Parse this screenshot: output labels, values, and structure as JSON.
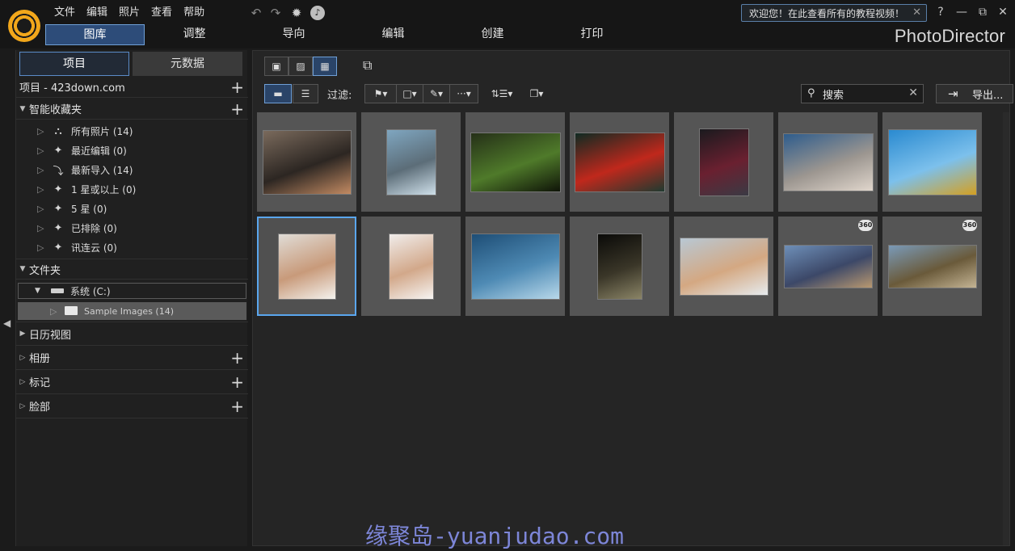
{
  "menu": [
    "文件",
    "编辑",
    "照片",
    "查看",
    "帮助"
  ],
  "welcome": "欢迎您！在此查看所有的教程视频！",
  "window_controls": {
    "help": "?",
    "minimize": "—",
    "restore": "⧉",
    "close": "✕"
  },
  "mode_tabs": [
    "图库",
    "调整",
    "导向",
    "编辑",
    "创建",
    "打印"
  ],
  "brand": "PhotoDirector",
  "left_tabs": [
    "项目",
    "元数据"
  ],
  "project_label": "项目 - 423down.com",
  "sections": {
    "smart": "智能收藏夹",
    "folder": "文件夹",
    "calendar": "日历视图",
    "album": "相册",
    "tags": "标记",
    "faces": "脸部"
  },
  "smart_items": [
    {
      "label": "所有照片 (14)",
      "icon": "tree-icon"
    },
    {
      "label": "最近编辑 (0)",
      "icon": "sparkle-icon"
    },
    {
      "label": "最新导入 (14)",
      "icon": "import-arrow-icon"
    },
    {
      "label": "1 星或以上 (0)",
      "icon": "sparkle-icon"
    },
    {
      "label": "5 星 (0)",
      "icon": "sparkle-icon"
    },
    {
      "label": "已排除 (0)",
      "icon": "sparkle-icon"
    },
    {
      "label": "讯连云 (0)",
      "icon": "sparkle-icon"
    }
  ],
  "folder_items": [
    "系统 (C:)",
    "Sample Images (14)"
  ],
  "toolbar": {
    "filter_label": "过滤:",
    "search_placeholder": "搜索",
    "export_label": "导出..."
  },
  "thumbnails": [
    {
      "name": "basketball-dunk",
      "colors": [
        "#7a6a5c",
        "#2c2622",
        "#c28a62"
      ],
      "badge": ""
    },
    {
      "name": "sea-rock",
      "colors": [
        "#7fa6c0",
        "#5c6d78",
        "#cfe0ea"
      ],
      "badge": ""
    },
    {
      "name": "forest",
      "colors": [
        "#253018",
        "#4f7a2a",
        "#0f1408"
      ],
      "badge": ""
    },
    {
      "name": "red-leaf",
      "colors": [
        "#0f2a22",
        "#c0281c",
        "#1f3a30"
      ],
      "badge": ""
    },
    {
      "name": "neon-building",
      "colors": [
        "#1a1a1e",
        "#6a2030",
        "#3a3a44"
      ],
      "badge": ""
    },
    {
      "name": "rocket-launch",
      "colors": [
        "#2e5c8c",
        "#9c9690",
        "#e0d6cc"
      ],
      "badge": ""
    },
    {
      "name": "skateboarder",
      "colors": [
        "#2a8ad0",
        "#7cc0ec",
        "#d4a022"
      ],
      "badge": ""
    },
    {
      "name": "smiling-woman",
      "colors": [
        "#e0dcd6",
        "#c89a7a",
        "#f4f2ee"
      ],
      "badge": ""
    },
    {
      "name": "laughing-woman",
      "colors": [
        "#f0ecea",
        "#d2a88a",
        "#f6f4f2"
      ],
      "badge": ""
    },
    {
      "name": "ocean-wave",
      "colors": [
        "#1e4e76",
        "#4e8ab4",
        "#b8d8ea"
      ],
      "badge": ""
    },
    {
      "name": "dark-window",
      "colors": [
        "#0a0a08",
        "#3a3628",
        "#8a8466"
      ],
      "badge": ""
    },
    {
      "name": "woman-beach",
      "colors": [
        "#b8c8d4",
        "#d4a882",
        "#e6ebee"
      ],
      "badge": ""
    },
    {
      "name": "panorama-wall",
      "colors": [
        "#6e8fb8",
        "#3c4868",
        "#b89870"
      ],
      "badge": "360"
    },
    {
      "name": "panorama-valley",
      "colors": [
        "#7a9ab8",
        "#6a5a3a",
        "#c4b494"
      ],
      "badge": "360"
    }
  ],
  "watermark": "缘聚岛-yuanjudao.com"
}
